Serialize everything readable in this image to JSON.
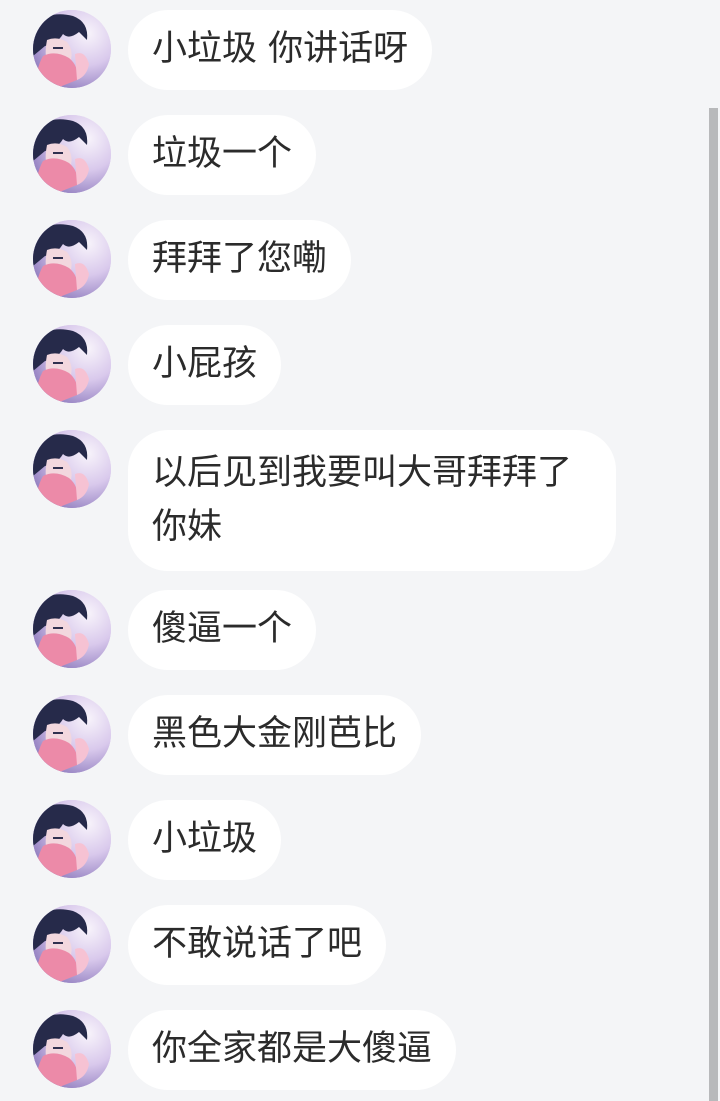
{
  "messages": [
    {
      "text": "小垃圾 你讲话呀",
      "avatar": "user-avatar"
    },
    {
      "text": "垃圾一个",
      "avatar": "user-avatar"
    },
    {
      "text": "拜拜了您嘞",
      "avatar": "user-avatar"
    },
    {
      "text": "小屁孩",
      "avatar": "user-avatar"
    },
    {
      "text": "以后见到我要叫大哥拜拜了你妹",
      "avatar": "user-avatar"
    },
    {
      "text": "傻逼一个",
      "avatar": "user-avatar"
    },
    {
      "text": "黑色大金刚芭比",
      "avatar": "user-avatar"
    },
    {
      "text": "小垃圾",
      "avatar": "user-avatar"
    },
    {
      "text": "不敢说话了吧",
      "avatar": "user-avatar"
    },
    {
      "text": "你全家都是大傻逼",
      "avatar": "user-avatar"
    }
  ],
  "colors": {
    "background": "#f4f5f7",
    "bubble": "#ffffff",
    "text": "#2b2b2b"
  }
}
